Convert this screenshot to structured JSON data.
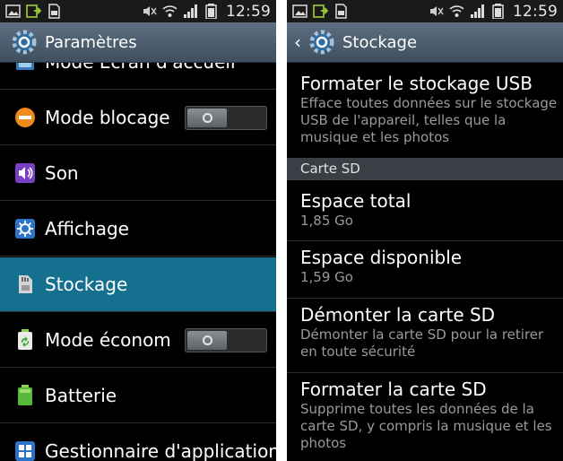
{
  "status_bar": {
    "time": "12:59"
  },
  "left_panel": {
    "title": "Paramètres",
    "items": [
      {
        "label": "Mode Ecran d'accueil",
        "icon": "home-screen-icon",
        "toggle": false
      },
      {
        "label": "Mode blocage",
        "icon": "blocking-icon",
        "toggle": true,
        "toggle_on": false
      },
      {
        "label": "Son",
        "icon": "speaker-icon",
        "toggle": false
      },
      {
        "label": "Affichage",
        "icon": "display-icon",
        "toggle": false
      },
      {
        "label": "Stockage",
        "icon": "sd-card-icon",
        "toggle": false,
        "selected": true
      },
      {
        "label": "Mode économie d'énergie",
        "icon": "power-saving-icon",
        "toggle": true,
        "toggle_on": false
      },
      {
        "label": "Batterie",
        "icon": "battery-icon",
        "toggle": false
      },
      {
        "label": "Gestionnaire d'applications",
        "icon": "app-manager-icon",
        "toggle": false
      }
    ]
  },
  "right_panel": {
    "title": "Stockage",
    "usb_format": {
      "title": "Formater le stockage USB",
      "description": "Efface toutes données sur le stockage USB de l'appareil, telles que la musique et les photos"
    },
    "section_label": "Carte SD",
    "total_space": {
      "title": "Espace total",
      "value": "1,85 Go"
    },
    "available_space": {
      "title": "Espace disponible",
      "value": "1,59 Go"
    },
    "unmount_sd": {
      "title": "Démonter la carte SD",
      "description": "Démonter la carte SD pour la retirer en toute sécurité"
    },
    "format_sd": {
      "title": "Formater la carte SD",
      "description": "Supprime toutes les données de la carte SD, y compris la musique et les photos"
    }
  },
  "colors": {
    "selected_row": "#15708f",
    "title_bar": "#4e5f70",
    "section_header": "#3a3f45"
  }
}
